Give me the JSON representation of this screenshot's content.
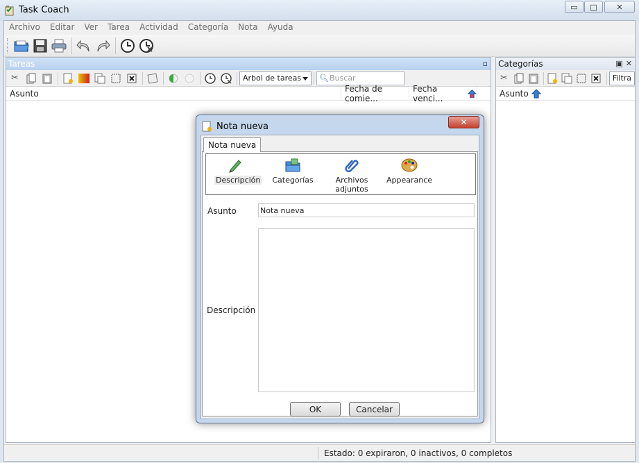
{
  "window": {
    "title": "Task Coach",
    "minimize_glyph": "▭",
    "maximize_glyph": "□",
    "close_glyph": "✕"
  },
  "menu": [
    "Archivo",
    "Editar",
    "Ver",
    "Tarea",
    "Actividad",
    "Categoría",
    "Nota",
    "Ayuda"
  ],
  "toolbar_icons": [
    "open-folder-icon",
    "save-icon",
    "print-icon",
    "undo-icon",
    "redo-icon",
    "clock-start-icon",
    "clock-stop-icon"
  ],
  "tasks_panel": {
    "title": "Tareas",
    "view_select": "Arbol de tareas",
    "search_placeholder": "Buscar",
    "columns": [
      "Asunto",
      "Fecha de comie...",
      "Fecha venci..."
    ]
  },
  "categories_panel": {
    "title": "Categorías",
    "filter_label": "Filtra",
    "columns": [
      "Asunto"
    ]
  },
  "status": {
    "text": "Estado:  0 expiraron, 0 inactivos, 0 completos"
  },
  "dialog": {
    "title": "Nota nueva",
    "close_glyph": "✕",
    "tab": "Nota nueva",
    "pages": [
      {
        "label": "Descripción",
        "icon": "pencil-icon"
      },
      {
        "label": "Categorías",
        "icon": "folders-icon"
      },
      {
        "label": "Archivos adjuntos",
        "icon": "paperclip-icon"
      },
      {
        "label": "Appearance",
        "icon": "palette-icon"
      }
    ],
    "subject_label": "Asunto",
    "subject_value": "Nota nueva",
    "description_label": "Descripción",
    "description_value": "",
    "ok_label": "OK",
    "cancel_label": "Cancelar"
  },
  "colors": {
    "panel_header_active": "#b7d1ee",
    "dialog_frame": "#c5d7ec",
    "close_red": "#c4402e"
  }
}
